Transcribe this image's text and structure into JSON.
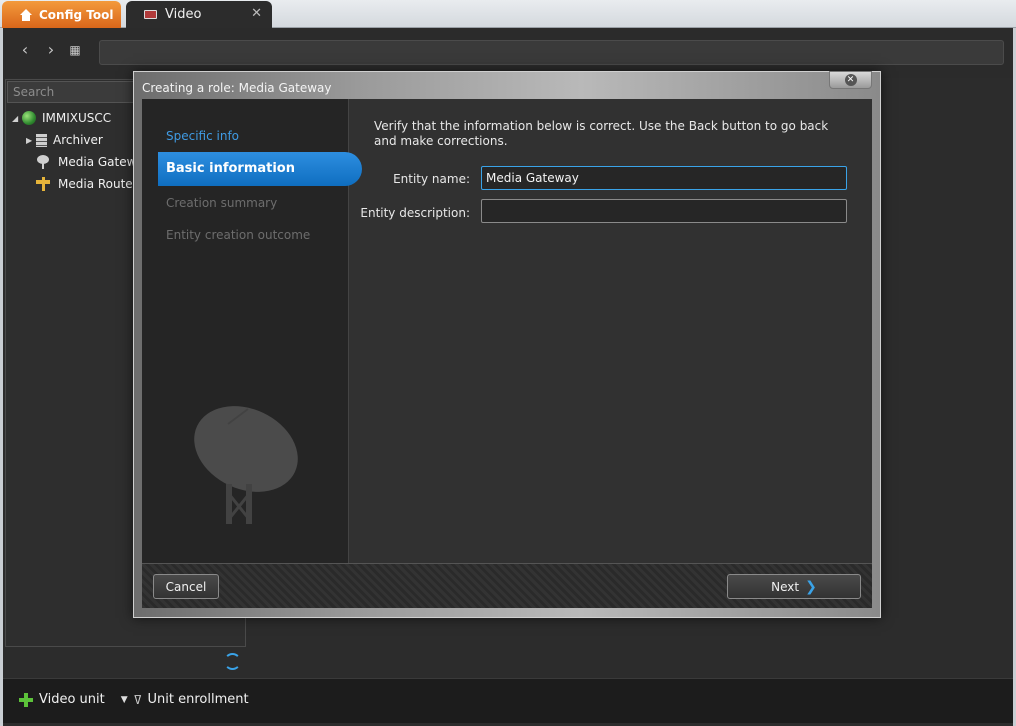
{
  "tabs": {
    "config_tool": "Config Tool",
    "video": "Video",
    "close_glyph": "✕"
  },
  "toolbar": {
    "back_glyph": "‹",
    "forward_glyph": "›",
    "address_value": ""
  },
  "tree": {
    "search_placeholder": "Search",
    "items": [
      {
        "label": "IMMIXUSCC",
        "icon": "globe-icon",
        "expanded": true
      },
      {
        "label": "Archiver",
        "icon": "server-icon",
        "expanded": false
      },
      {
        "label": "Media Gatewa",
        "icon": "satellite-dish-icon"
      },
      {
        "label": "Media Router",
        "icon": "router-icon"
      }
    ]
  },
  "bottom_bar": {
    "video_unit": "Video unit",
    "unit_enrollment": "Unit enrollment"
  },
  "dialog": {
    "title": "Creating a role: Media Gateway",
    "steps": [
      {
        "label": "Specific info",
        "state": "done"
      },
      {
        "label": "Basic information",
        "state": "active"
      },
      {
        "label": "Creation summary",
        "state": "pending"
      },
      {
        "label": "Entity creation outcome",
        "state": "pending"
      }
    ],
    "instructions": "Verify that the information below is correct. Use the Back button to go back and make corrections.",
    "entity_name_label": "Entity name:",
    "entity_name_value": "Media Gateway",
    "entity_description_label": "Entity description:",
    "entity_description_value": "",
    "cancel_label": "Cancel",
    "next_label": "Next"
  },
  "colors": {
    "accent": "#3aa3e8",
    "config_tab": "#e8822a",
    "active_step": "#1a7dd4"
  }
}
